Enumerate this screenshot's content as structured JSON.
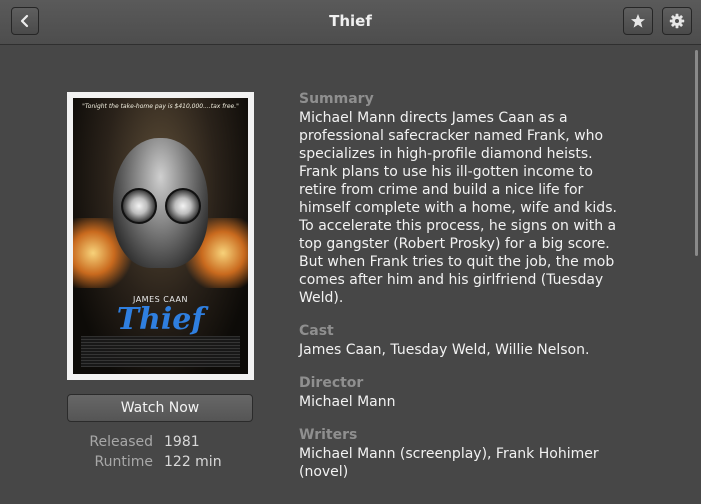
{
  "window": {
    "title": "Thief"
  },
  "header": {
    "back_icon": "go-back-icon",
    "favorite_icon": "star-icon",
    "settings_icon": "gear-icon"
  },
  "poster": {
    "tagline": "\"Tonight the take-home pay is $410,000....tax free.\"",
    "actor": "JAMES CAAN",
    "logo_text": "Thief"
  },
  "actions": {
    "watch_label": "Watch Now"
  },
  "meta": [
    {
      "label": "Released",
      "value": "1981"
    },
    {
      "label": "Runtime",
      "value": "122 min"
    }
  ],
  "details": {
    "summary_label": "Summary",
    "summary_text": "Michael Mann directs James Caan as a professional safecracker named Frank, who specializes in high-profile diamond heists. Frank plans to use his ill-gotten income to retire from crime and build a nice life for himself complete with a home, wife and kids. To accelerate this process, he signs on with a top gangster (Robert Prosky) for a big score. But when Frank tries to quit the job, the mob comes after him and his girlfriend (Tuesday Weld).",
    "cast_label": "Cast",
    "cast_text": "James Caan, Tuesday Weld, Willie Nelson.",
    "director_label": "Director",
    "director_text": "Michael Mann",
    "writers_label": "Writers",
    "writers_text": "Michael Mann (screenplay), Frank Hohimer (novel)"
  }
}
